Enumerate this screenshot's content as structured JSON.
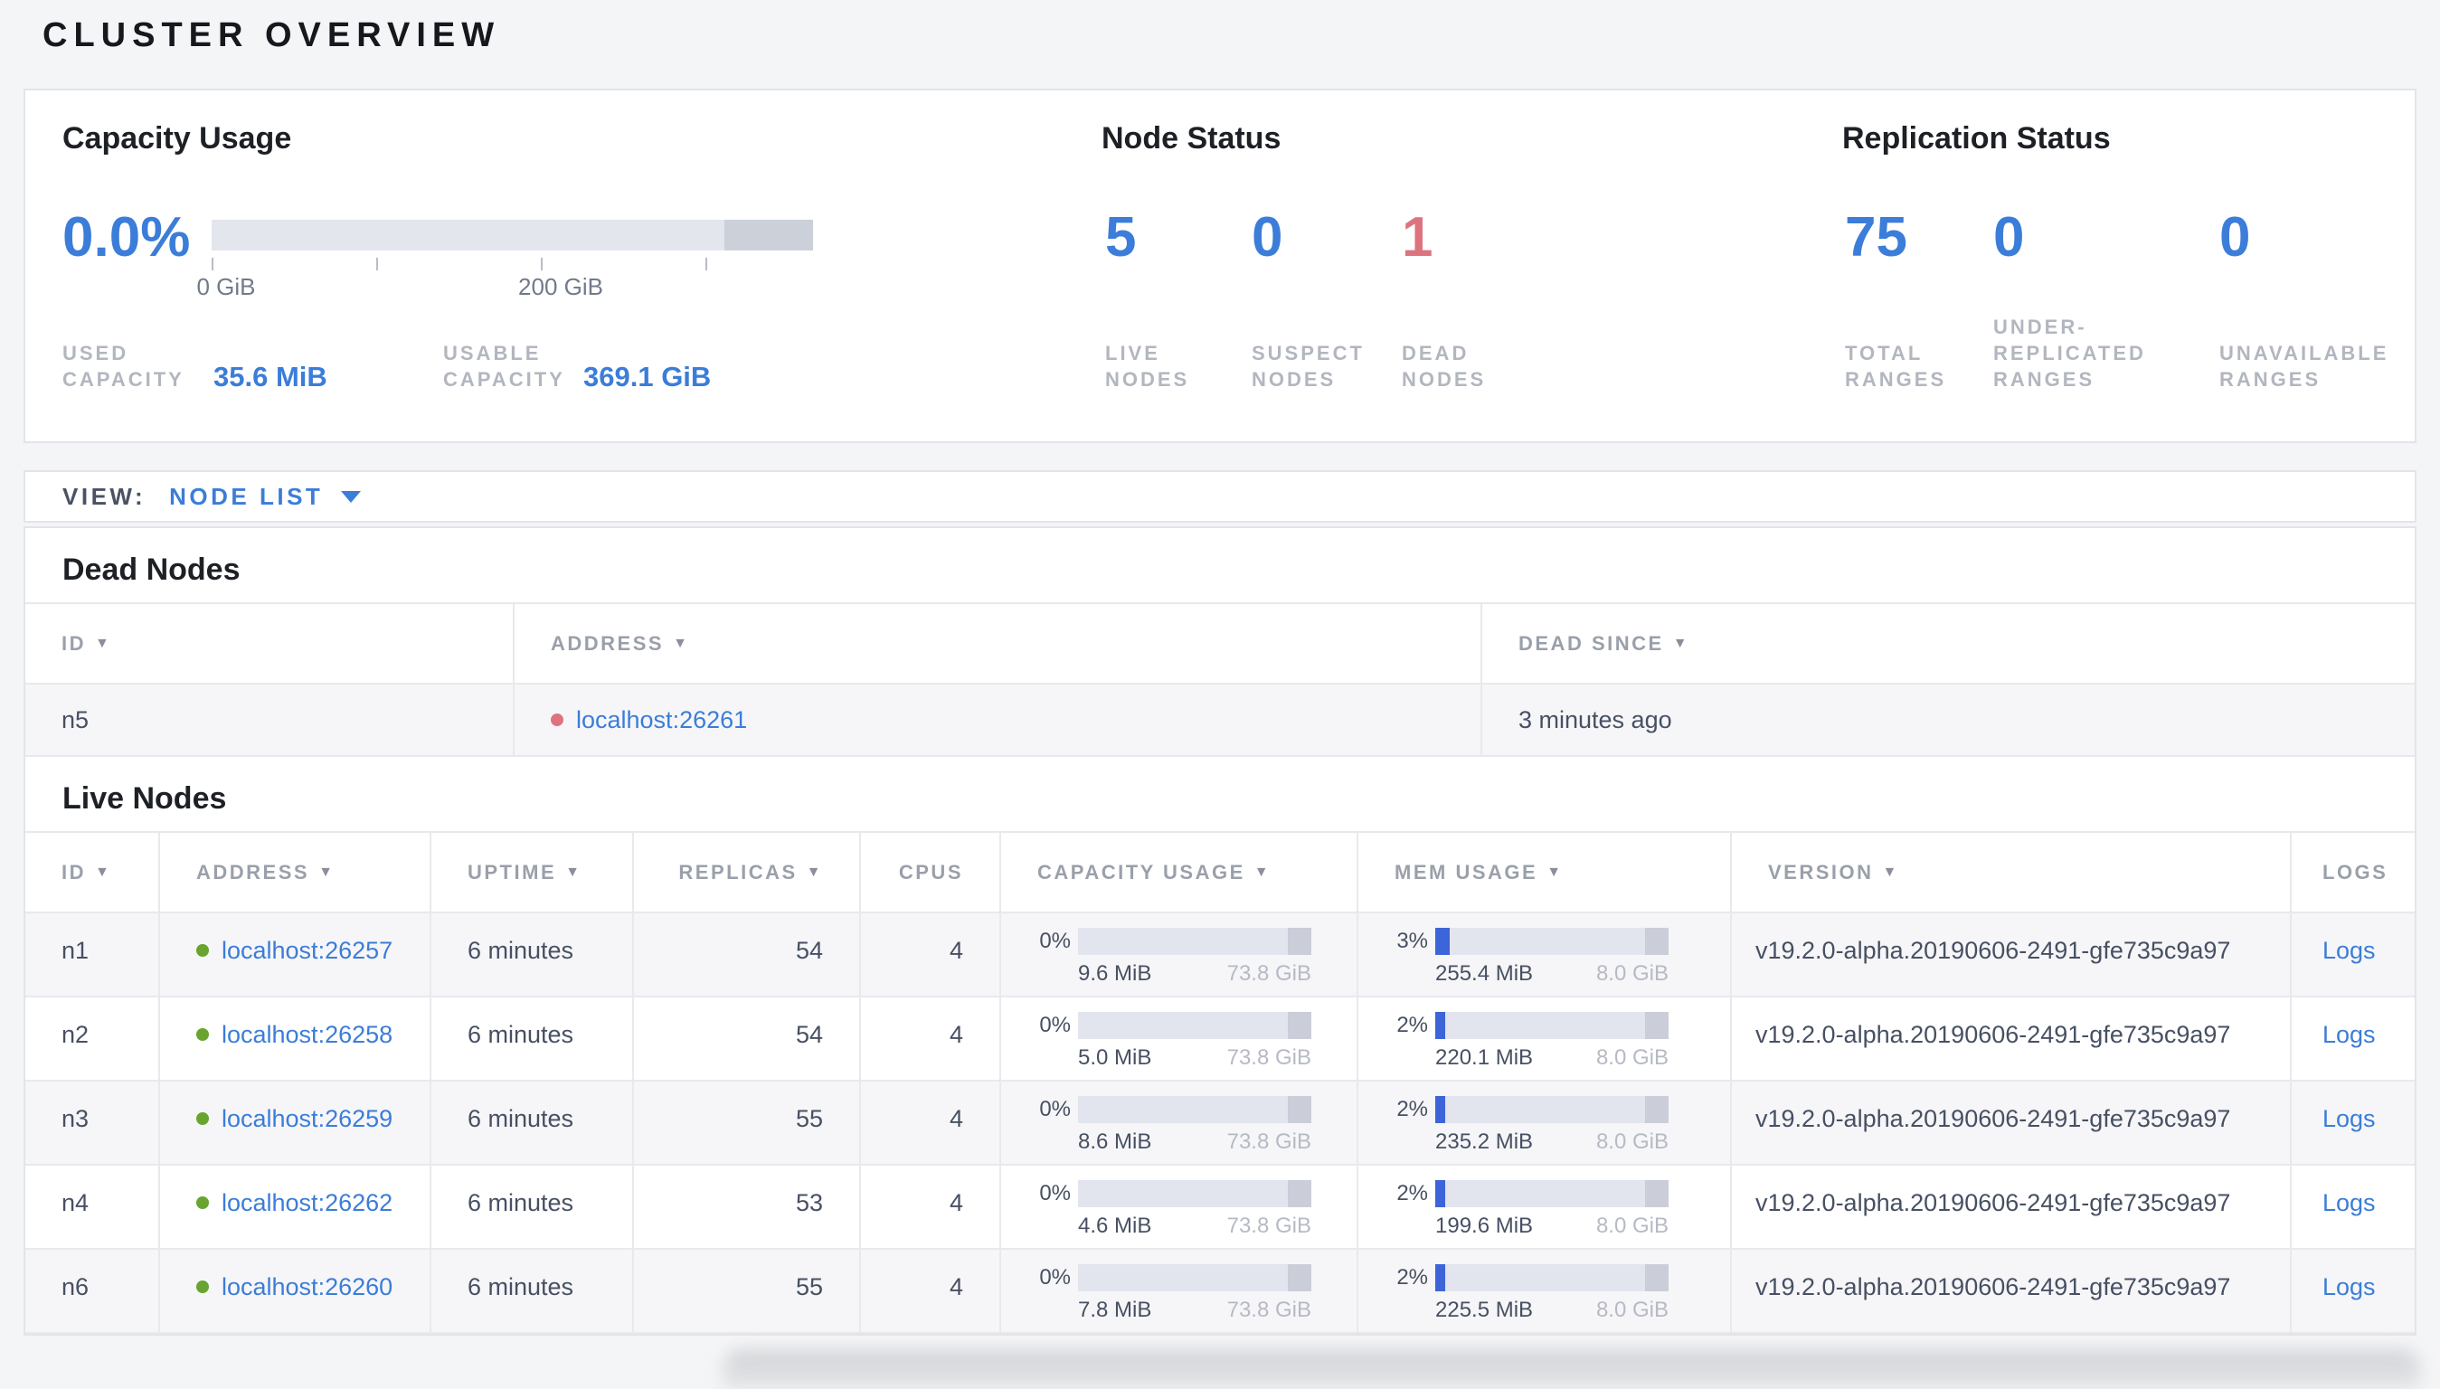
{
  "page_title": "CLUSTER OVERVIEW",
  "colors": {
    "accent_blue": "#3b7dd8",
    "danger_red": "#de7380",
    "live_green": "#68a42f",
    "mem_fill_blue": "#3d64d8"
  },
  "summary": {
    "capacity": {
      "title": "Capacity Usage",
      "percent": "0.0%",
      "percent_num": 0,
      "tick_labels": [
        "0 GiB",
        "200 GiB"
      ],
      "used": {
        "label_lines": [
          "USED",
          "CAPACITY"
        ],
        "value": "35.6 MiB"
      },
      "usable": {
        "label_lines": [
          "USABLE",
          "CAPACITY"
        ],
        "value": "369.1 GiB"
      }
    },
    "node_status": {
      "title": "Node Status",
      "stats": [
        {
          "value": "5",
          "label_lines": [
            "LIVE",
            "NODES"
          ],
          "color": "blue"
        },
        {
          "value": "0",
          "label_lines": [
            "SUSPECT",
            "NODES"
          ],
          "color": "blue"
        },
        {
          "value": "1",
          "label_lines": [
            "DEAD",
            "NODES"
          ],
          "color": "red"
        }
      ]
    },
    "replication": {
      "title": "Replication Status",
      "stats": [
        {
          "value": "75",
          "label_lines": [
            "TOTAL",
            "RANGES"
          ],
          "color": "blue"
        },
        {
          "value": "0",
          "label_lines": [
            "UNDER-",
            "REPLICATED",
            "RANGES"
          ],
          "color": "blue"
        },
        {
          "value": "0",
          "label_lines": [
            "UNAVAILABLE",
            "RANGES"
          ],
          "color": "blue"
        }
      ]
    }
  },
  "view_bar": {
    "label": "VIEW:",
    "value": "NODE LIST"
  },
  "dead_nodes": {
    "title": "Dead Nodes",
    "columns": [
      {
        "label": "ID",
        "sortable": true
      },
      {
        "label": "ADDRESS",
        "sortable": true
      },
      {
        "label": "DEAD SINCE",
        "sortable": true
      }
    ],
    "rows": [
      {
        "id": "n5",
        "address": "localhost:26261",
        "dead_since": "3 minutes ago"
      }
    ]
  },
  "live_nodes": {
    "title": "Live Nodes",
    "columns": [
      {
        "label": "ID",
        "sortable": true
      },
      {
        "label": "ADDRESS",
        "sortable": true
      },
      {
        "label": "UPTIME",
        "sortable": true
      },
      {
        "label": "REPLICAS",
        "sortable": true
      },
      {
        "label": "CPUS",
        "sortable": false
      },
      {
        "label": "CAPACITY USAGE",
        "sortable": true
      },
      {
        "label": "MEM USAGE",
        "sortable": true
      },
      {
        "label": "VERSION",
        "sortable": true
      },
      {
        "label": "LOGS",
        "sortable": false
      }
    ],
    "rows": [
      {
        "id": "n1",
        "address": "localhost:26257",
        "uptime": "6 minutes",
        "replicas": "54",
        "cpus": "4",
        "capacity": {
          "percent": "0%",
          "percent_num": 0,
          "used": "9.6 MiB",
          "total": "73.8 GiB"
        },
        "mem": {
          "percent": "3%",
          "percent_num": 3,
          "used": "255.4 MiB",
          "total": "8.0 GiB"
        },
        "version": "v19.2.0-alpha.20190606-2491-gfe735c9a97",
        "logs_label": "Logs"
      },
      {
        "id": "n2",
        "address": "localhost:26258",
        "uptime": "6 minutes",
        "replicas": "54",
        "cpus": "4",
        "capacity": {
          "percent": "0%",
          "percent_num": 0,
          "used": "5.0 MiB",
          "total": "73.8 GiB"
        },
        "mem": {
          "percent": "2%",
          "percent_num": 2,
          "used": "220.1 MiB",
          "total": "8.0 GiB"
        },
        "version": "v19.2.0-alpha.20190606-2491-gfe735c9a97",
        "logs_label": "Logs"
      },
      {
        "id": "n3",
        "address": "localhost:26259",
        "uptime": "6 minutes",
        "replicas": "55",
        "cpus": "4",
        "capacity": {
          "percent": "0%",
          "percent_num": 0,
          "used": "8.6 MiB",
          "total": "73.8 GiB"
        },
        "mem": {
          "percent": "2%",
          "percent_num": 2,
          "used": "235.2 MiB",
          "total": "8.0 GiB"
        },
        "version": "v19.2.0-alpha.20190606-2491-gfe735c9a97",
        "logs_label": "Logs"
      },
      {
        "id": "n4",
        "address": "localhost:26262",
        "uptime": "6 minutes",
        "replicas": "53",
        "cpus": "4",
        "capacity": {
          "percent": "0%",
          "percent_num": 0,
          "used": "4.6 MiB",
          "total": "73.8 GiB"
        },
        "mem": {
          "percent": "2%",
          "percent_num": 2,
          "used": "199.6 MiB",
          "total": "8.0 GiB"
        },
        "version": "v19.2.0-alpha.20190606-2491-gfe735c9a97",
        "logs_label": "Logs"
      },
      {
        "id": "n6",
        "address": "localhost:26260",
        "uptime": "6 minutes",
        "replicas": "55",
        "cpus": "4",
        "capacity": {
          "percent": "0%",
          "percent_num": 0,
          "used": "7.8 MiB",
          "total": "73.8 GiB"
        },
        "mem": {
          "percent": "2%",
          "percent_num": 2,
          "used": "225.5 MiB",
          "total": "8.0 GiB"
        },
        "version": "v19.2.0-alpha.20190606-2491-gfe735c9a97",
        "logs_label": "Logs"
      }
    ]
  }
}
